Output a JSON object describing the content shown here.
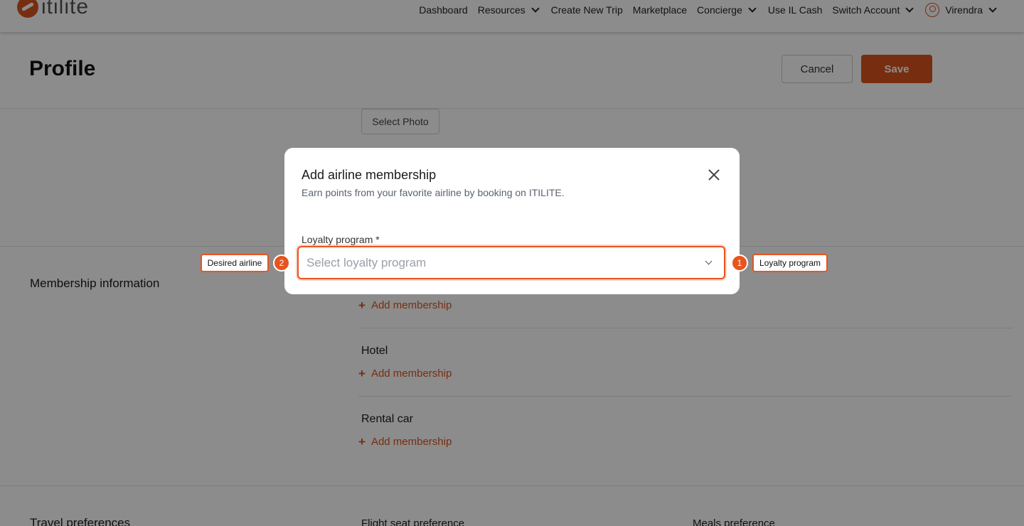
{
  "nav": {
    "logo": "itilite",
    "links": [
      "Dashboard",
      "Resources",
      "Create New Trip",
      "Marketplace",
      "Concierge",
      "Use IL Cash",
      "Switch Account",
      "Virendra"
    ]
  },
  "page": {
    "title": "Profile",
    "cancel_label": "Cancel",
    "save_label": "Save",
    "select_photo_label": "Select Photo"
  },
  "membership": {
    "section_label": "Membership information",
    "add_label": "Add membership",
    "groups": [
      "Hotel",
      "Rental car"
    ]
  },
  "travel": {
    "section_label": "Travel preferences",
    "flight_seat_label": "Flight seat preference",
    "meals_label": "Meals preference"
  },
  "modal": {
    "title": "Add airline membership",
    "subtitle": "Earn points from your favorite airline by booking on ITILITE.",
    "field_label": "Loyalty program *",
    "placeholder": "Select loyalty program"
  },
  "annotations": [
    {
      "num": "1",
      "label": "Loyalty program"
    },
    {
      "num": "2",
      "label": "Desired airline"
    }
  ],
  "colors": {
    "accent": "#d9541e",
    "highlight": "#e8541e"
  }
}
